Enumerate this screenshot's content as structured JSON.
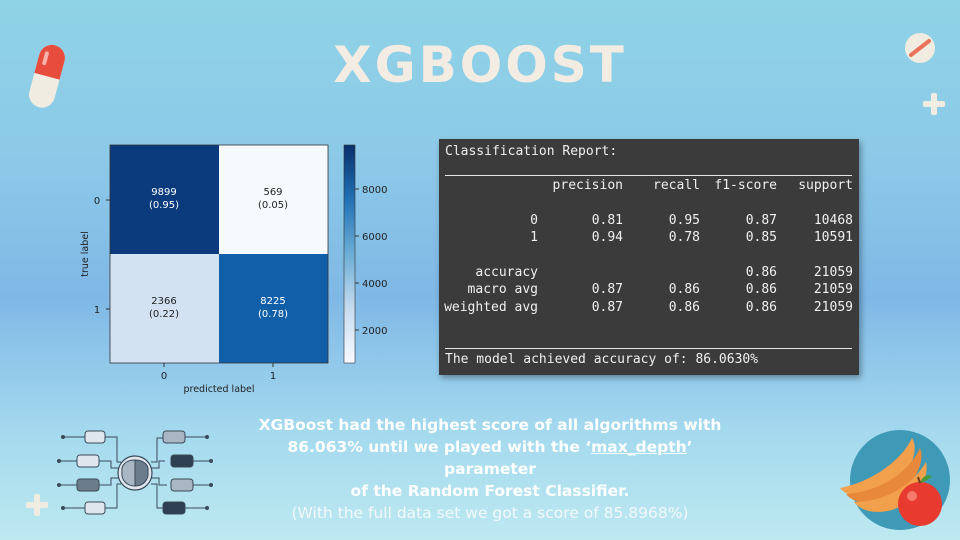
{
  "title": "XGBOOST",
  "confusion_matrix": {
    "cells": [
      {
        "count": "9899",
        "pct": "(0.95)",
        "color": "#0b3b7c"
      },
      {
        "count": "569",
        "pct": "(0.05)",
        "color": "#f5fafe"
      },
      {
        "count": "2366",
        "pct": "(0.22)",
        "color": "#d3e2f3"
      },
      {
        "count": "8225",
        "pct": "(0.78)",
        "color": "#115fa8"
      }
    ],
    "y_ticks": [
      "0",
      "1"
    ],
    "x_ticks": [
      "0",
      "1"
    ],
    "ylabel": "true label",
    "xlabel": "predicted label",
    "colorbar_ticks": [
      "8000",
      "6000",
      "4000",
      "2000"
    ]
  },
  "report": {
    "title": "Classification Report:",
    "headers": [
      "precision",
      "recall",
      "f1-score",
      "support"
    ],
    "rows": [
      {
        "label": "0",
        "values": [
          "0.81",
          "0.95",
          "0.87",
          "10468"
        ]
      },
      {
        "label": "1",
        "values": [
          "0.94",
          "0.78",
          "0.85",
          "10591"
        ]
      },
      {
        "label": "accuracy",
        "values": [
          "",
          "",
          "0.86",
          "21059"
        ]
      },
      {
        "label": "macro avg",
        "values": [
          "0.87",
          "0.86",
          "0.86",
          "21059"
        ]
      },
      {
        "label": "weighted avg",
        "values": [
          "0.87",
          "0.86",
          "0.86",
          "21059"
        ]
      }
    ],
    "accuracy_line": "The model achieved accuracy of: 86.0630%"
  },
  "caption": {
    "line1": "XGBoost had the highest score of all algorithms with",
    "line2_pre": "86.063% until we played with the ‘",
    "line2_param": "max_depth",
    "line2_post": "’ parameter",
    "line3": "of the Random Forest Classifier.",
    "line4": "(With the full data set we got a score of 85.8968%)"
  }
}
